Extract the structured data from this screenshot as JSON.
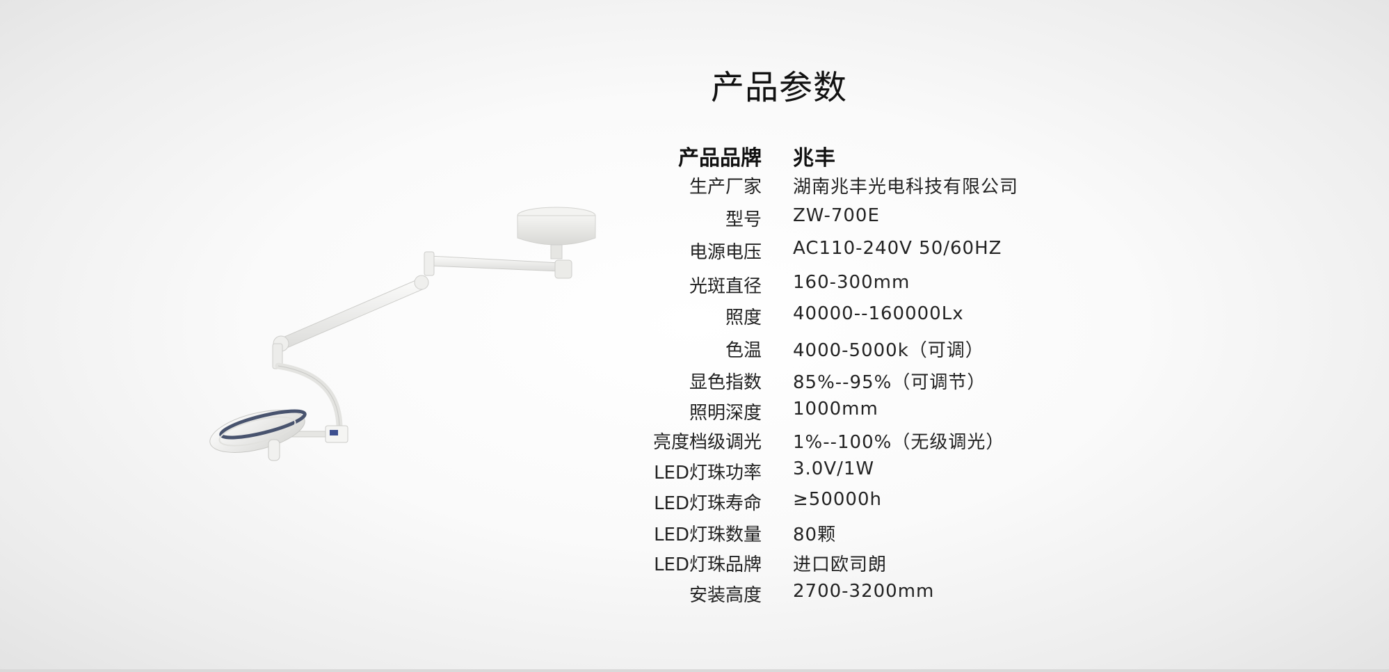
{
  "page": {
    "title": "产品参数"
  },
  "specs": [
    {
      "label": "产品品牌",
      "value": "兆丰"
    },
    {
      "label": "生产厂家",
      "value": "湖南兆丰光电科技有限公司"
    },
    {
      "label": "型号",
      "value": "ZW-700E"
    },
    {
      "label": "电源电压",
      "value": "AC110-240V   50/60HZ"
    },
    {
      "label": "光斑直径",
      "value": "160-300mm"
    },
    {
      "label": "照度",
      "value": "40000--160000Lx"
    },
    {
      "label": "色温",
      "value": "4000-5000k（可调）"
    },
    {
      "label": "显色指数",
      "value": "85%--95%（可调节）"
    },
    {
      "label": "照明深度",
      "value": "1000mm"
    },
    {
      "label": "亮度档级调光",
      "value": "1%--100%（无级调光）"
    },
    {
      "label": "LED灯珠功率",
      "value": "3.0V/1W"
    },
    {
      "label": "LED灯珠寿命",
      "value": "≥50000h"
    },
    {
      "label": "LED灯珠数量",
      "value": "80颗"
    },
    {
      "label": "LED灯珠品牌",
      "value": "进口欧司朗"
    },
    {
      "label": "安装高度",
      "value": "2700-3200mm"
    }
  ],
  "illustration": {
    "icon": "surgical-lamp-icon"
  },
  "colors": {
    "background": "#f7f7f7",
    "text": "#1a1a1a",
    "lamp_body": "#eeeeec",
    "lamp_ring": "#3f4a66"
  }
}
